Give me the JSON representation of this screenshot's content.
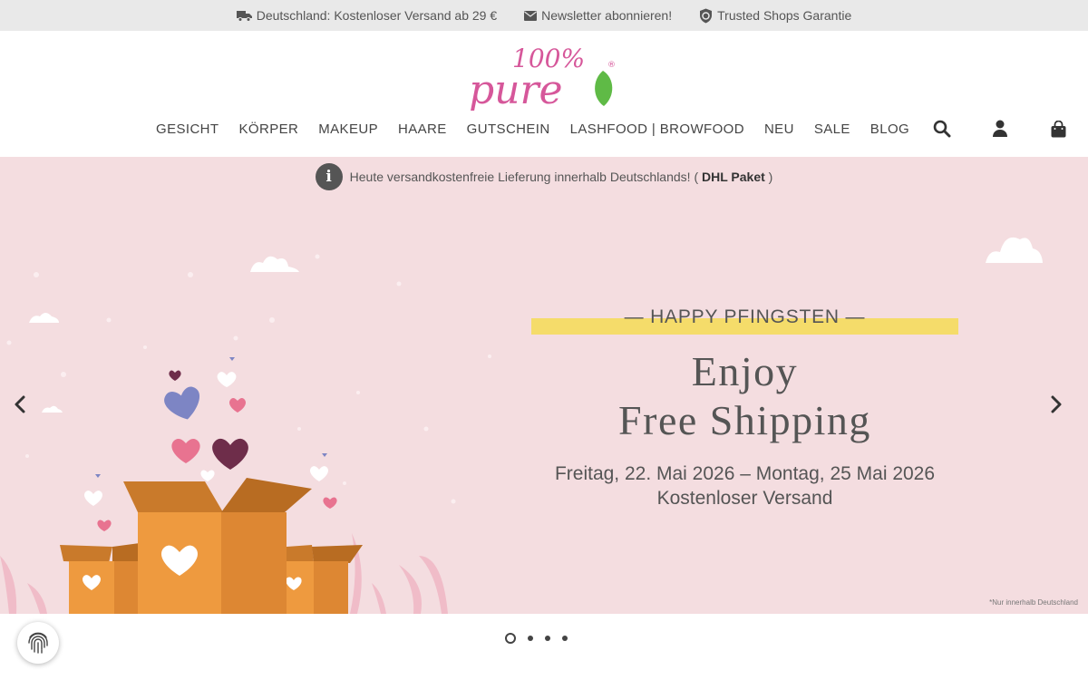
{
  "topbar": {
    "shipping": "Deutschland: Kostenloser Versand ab 29 €",
    "newsletter": "Newsletter abonnieren!",
    "trusted": "Trusted Shops Garantie"
  },
  "logo": {
    "line1": "100%",
    "line2": "pure",
    "mark": "®"
  },
  "nav": {
    "items": [
      "GESICHT",
      "KÖRPER",
      "MAKEUP",
      "HAARE",
      "GUTSCHEIN",
      "LASHFOOD | BROWFOOD",
      "NEU",
      "SALE",
      "BLOG"
    ]
  },
  "notice": {
    "icon": "i",
    "text": "Heute versandkostenfreie Lieferung innerhalb Deutschlands! (",
    "bold": "DHL Paket",
    "close": ")"
  },
  "hero": {
    "tagline": "— HAPPY PFINGSTEN —",
    "headline_1": "Enjoy",
    "headline_2": "Free Shipping",
    "dates_1": "Freitag, 22. Mai 2026 – Montag, 25 Mai 2026",
    "dates_2": "Kostenloser Versand",
    "footnote": "*Nur innerhalb Deutschland"
  },
  "icons": {
    "shipping": "truck-icon",
    "newsletter": "envelope-icon",
    "trusted": "shield-check-icon",
    "search": "search-icon",
    "account": "user-icon",
    "cart": "shopping-bag-icon",
    "prev": "chevron-left-icon",
    "next": "chevron-right-icon",
    "privacy": "fingerprint-icon"
  },
  "colors": {
    "hero_bg": "#f4dde0",
    "tagline_bar": "#f5dc6a",
    "box": "#ee9a3f",
    "logo_pink": "#d6579a",
    "leaf": "#5fba46"
  },
  "carousel": {
    "slides": 4,
    "active": 1
  }
}
